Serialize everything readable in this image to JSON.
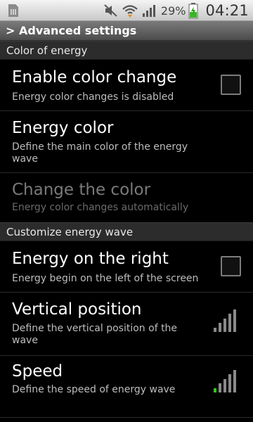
{
  "status_bar": {
    "battery_percent": "29%",
    "time": "04:21",
    "icons": [
      "sim-card-icon",
      "mute-icon",
      "wifi-icon",
      "signal-icon",
      "battery-charging-icon"
    ]
  },
  "title_bar": {
    "title": "> Advanced settings"
  },
  "sections": [
    {
      "header": "Color of energy",
      "items": [
        {
          "title": "Enable color change",
          "summary": "Energy color changes is disabled",
          "widget": "checkbox",
          "checked": false,
          "enabled": true
        },
        {
          "title": "Energy color",
          "summary": "Define the main color of the energy wave",
          "widget": "none",
          "enabled": true
        },
        {
          "title": "Change the color",
          "summary": "Energy color changes automatically",
          "widget": "none",
          "enabled": false
        }
      ]
    },
    {
      "header": "Customize energy wave",
      "items": [
        {
          "title": "Energy on the right",
          "summary": "Energy begin on the left of the screen",
          "widget": "checkbox",
          "checked": false,
          "enabled": true
        },
        {
          "title": "Vertical position",
          "summary": "Define the vertical position of the wave",
          "widget": "level",
          "level": 0,
          "levels": 5,
          "enabled": true
        },
        {
          "title": "Speed",
          "summary": "Define the speed of energy wave",
          "widget": "level",
          "level": 1,
          "levels": 5,
          "enabled": true
        }
      ]
    }
  ],
  "colors": {
    "level_active": "#35c51f",
    "level_inactive": "#8a8a8a"
  }
}
